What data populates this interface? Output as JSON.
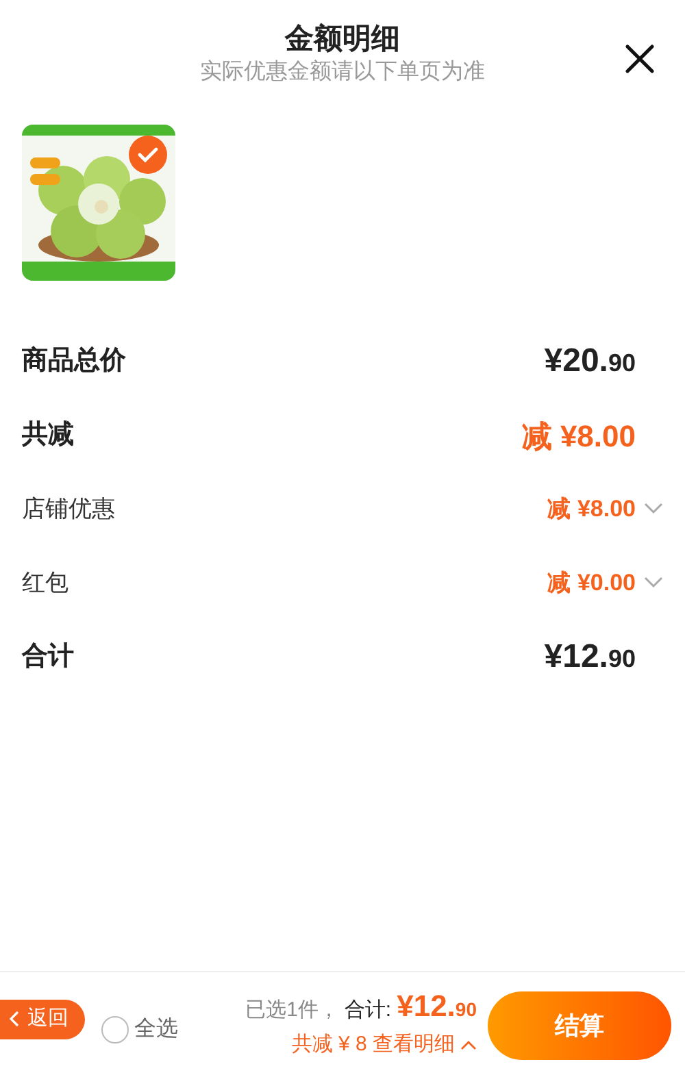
{
  "header": {
    "title": "金额明细",
    "subtitle": "实际优惠金额请以下单页为准"
  },
  "products": [
    {
      "kind": "picture",
      "selected": true
    }
  ],
  "rows": [
    {
      "kind": "total",
      "label": "商品总价",
      "amount": "¥20.90"
    },
    {
      "kind": "discount",
      "label": "共减",
      "amount": "减 ¥8.00"
    },
    {
      "kind": "detail",
      "label": "店铺优惠",
      "amount": "减 ¥8.00",
      "expanded": false
    },
    {
      "kind": "detail",
      "label": "红包",
      "amount": "减 ¥0.00",
      "expanded": false
    },
    {
      "kind": "total",
      "label": "合计",
      "amount": "¥12.90"
    }
  ],
  "bottom_bar": {
    "back_button": "返回",
    "select_all": {
      "label": "全选",
      "checked": false
    },
    "selected_count": "已选1件，",
    "total_label": "合计:",
    "total_amount": "¥12.90",
    "savings": "共减 ¥ 8 查看明细",
    "details_expanded": true,
    "checkout_button": "结算"
  }
}
